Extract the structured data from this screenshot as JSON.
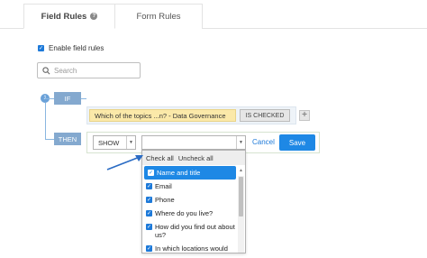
{
  "tabs": {
    "field_rules": "Field Rules",
    "form_rules": "Form Rules"
  },
  "enable": {
    "label": "Enable field rules",
    "checked": true
  },
  "search": {
    "placeholder": "Search"
  },
  "rule": {
    "number": "1",
    "if_label": "IF",
    "then_label": "THEN",
    "condition_field": "Which of the topics ...n? - Data Governance",
    "condition_operator": "IS CHECKED",
    "action": "SHOW",
    "cancel": "Cancel",
    "save": "Save"
  },
  "dropdown": {
    "check_all": "Check all",
    "uncheck_all": "Uncheck all",
    "items": [
      {
        "label": "Name and title",
        "checked": true,
        "selected": true
      },
      {
        "label": "Email",
        "checked": true,
        "selected": false
      },
      {
        "label": "Phone",
        "checked": true,
        "selected": false
      },
      {
        "label": "Where do you live?",
        "checked": true,
        "selected": false
      },
      {
        "label": "How did you find out about us?",
        "checked": true,
        "selected": false
      },
      {
        "label": "In which locations would",
        "checked": true,
        "selected": false
      }
    ]
  },
  "colors": {
    "accent": "#1e88e5",
    "tag": "#84a9cf",
    "condition_highlight": "#fbe9a9"
  }
}
